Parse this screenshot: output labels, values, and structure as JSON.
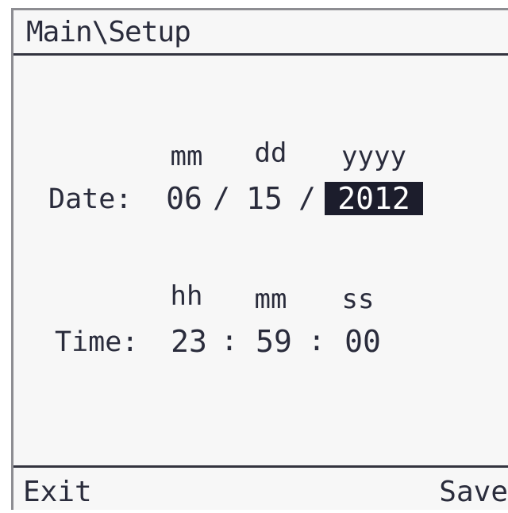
{
  "title": "Main\\Setup",
  "date": {
    "label": "Date:",
    "headers": [
      "mm",
      "dd",
      "yyyy"
    ],
    "month": "06",
    "day": "15",
    "year": "2012",
    "separator": "/"
  },
  "time": {
    "label": "Time:",
    "headers": [
      "hh",
      "mm",
      "ss"
    ],
    "hours": "23",
    "minutes": "59",
    "seconds": "00",
    "separator": ":"
  },
  "softkeys": {
    "left": "Exit",
    "right": "Save"
  },
  "colors": {
    "text": "#2a2c3c",
    "selection_bg": "#1c1d2c",
    "selection_fg": "#ffffff",
    "background": "#f7f7f7"
  }
}
